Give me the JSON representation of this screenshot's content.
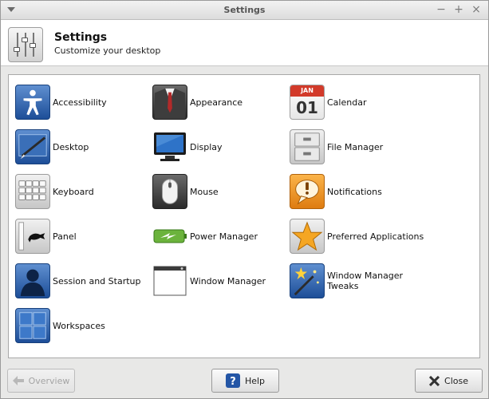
{
  "window": {
    "title": "Settings",
    "controls": {
      "minimize": "−",
      "maximize": "+",
      "close": "×"
    }
  },
  "header": {
    "title": "Settings",
    "subtitle": "Customize your desktop",
    "icon": "settings-sliders-icon"
  },
  "items": [
    {
      "label": "Accessibility",
      "icon": "accessibility-icon"
    },
    {
      "label": "Appearance",
      "icon": "appearance-suit-icon"
    },
    {
      "label": "Calendar",
      "icon": "calendar-icon",
      "calendar_month": "JAN",
      "calendar_day": "01"
    },
    {
      "label": "Desktop",
      "icon": "desktop-icon"
    },
    {
      "label": "Display",
      "icon": "display-monitor-icon"
    },
    {
      "label": "File Manager",
      "icon": "file-cabinet-icon"
    },
    {
      "label": "Keyboard",
      "icon": "keyboard-icon"
    },
    {
      "label": "Mouse",
      "icon": "mouse-icon"
    },
    {
      "label": "Notifications",
      "icon": "notification-bubble-icon"
    },
    {
      "label": "Panel",
      "icon": "panel-icon"
    },
    {
      "label": "Power Manager",
      "icon": "battery-icon"
    },
    {
      "label": "Preferred Applications",
      "icon": "star-icon"
    },
    {
      "label": "Session and Startup",
      "icon": "user-silhouette-icon"
    },
    {
      "label": "Window Manager",
      "icon": "window-icon"
    },
    {
      "label": "Window Manager\nTweaks",
      "icon": "wand-icon"
    },
    {
      "label": "Workspaces",
      "icon": "workspaces-grid-icon"
    }
  ],
  "footer": {
    "overview_label": "Overview",
    "help_label": "Help",
    "close_label": "Close"
  },
  "colors": {
    "blue_icon": "#1d4e98",
    "orange_icon": "#de7c10",
    "help_blue": "#2456a6",
    "background": "#e8e8e7"
  }
}
